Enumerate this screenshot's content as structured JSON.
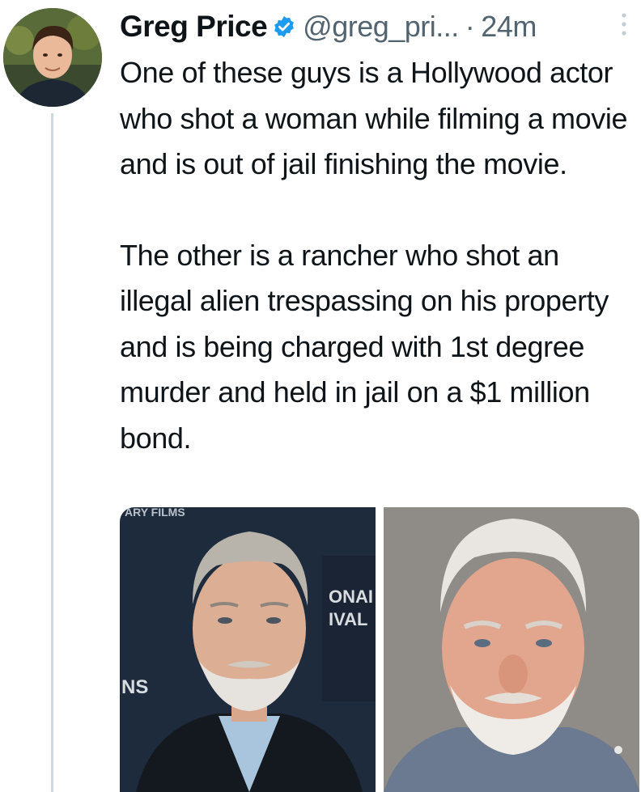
{
  "tweet": {
    "author": {
      "display_name": "Greg Price",
      "handle": "@greg_pri...",
      "verified": true,
      "avatar_icon": "user-avatar"
    },
    "separator": "·",
    "timestamp": "24m",
    "paragraphs": [
      "One of these guys is a Hollywood actor who shot a woman while filming a movie and is out of jail finishing the movie.",
      "The other is a rancher who shot an illegal alien trespassing on his property and is being charged with 1st degree murder and held in jail on a $1 million bond."
    ],
    "media": {
      "images": [
        {
          "backdrop_texts": [
            "ARY FILMS",
            "ONAI",
            "IVAL",
            "NS"
          ]
        },
        {}
      ]
    }
  },
  "colors": {
    "text": "#0f1419",
    "secondary": "#536471",
    "verified_blue": "#1d9bf0",
    "thread_line": "#cfd9de"
  }
}
